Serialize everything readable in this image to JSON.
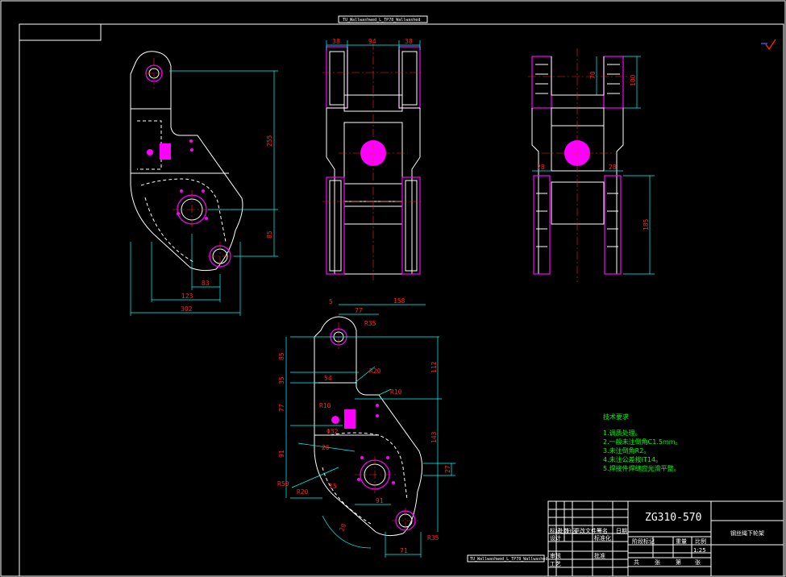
{
  "window": {
    "top_tag": "TU_Wallwashwed_L_TP78_Wallwashed",
    "bottom_tag": "TU_Wallwashwed_L_TP78_Wallwashed"
  },
  "views": {
    "side_view": {
      "dims": [
        "255",
        "85",
        "83",
        "123",
        "302"
      ]
    },
    "front_view": {
      "dims": [
        "38",
        "94",
        "38"
      ]
    },
    "right_view": {
      "dims": [
        "70",
        "100",
        "28",
        "28",
        "185"
      ]
    },
    "detail_view": {
      "dims": [
        "5",
        "77",
        "158",
        "R35",
        "85",
        "112",
        "35",
        "R20",
        "54",
        "R10",
        "R10",
        "77",
        "Φ32",
        "143",
        "26",
        "91",
        "R50",
        "R20",
        "27",
        "91",
        "R35",
        "20",
        "71",
        "15"
      ]
    }
  },
  "notes": {
    "title": "技术要求",
    "lines": [
      "1.调质处理。",
      "2.一般未注倒角C1.5mm。",
      "3.未注倒角R2。",
      "4.未注公差按IT14。",
      "5.焊接件焊缝应光滑平整。"
    ]
  },
  "title_block": {
    "drawing_no": "ZG310-570",
    "part_name": "钢丝绳下轮架",
    "scale": "1:25",
    "cells": [
      "标记",
      "处数",
      "分区",
      "更改文件号",
      "签名",
      "日期",
      "阶段标记",
      "重量",
      "比例",
      "设计",
      "标准化",
      "审核",
      "工艺",
      "批准",
      "共",
      "张",
      "第",
      "张"
    ]
  },
  "colors": {
    "background": "#000000",
    "outline": "#ffffff",
    "dimension": "#00ffff",
    "centerline": "#ff2020",
    "hatch": "#ff00ff",
    "notes": "#00ff00"
  }
}
